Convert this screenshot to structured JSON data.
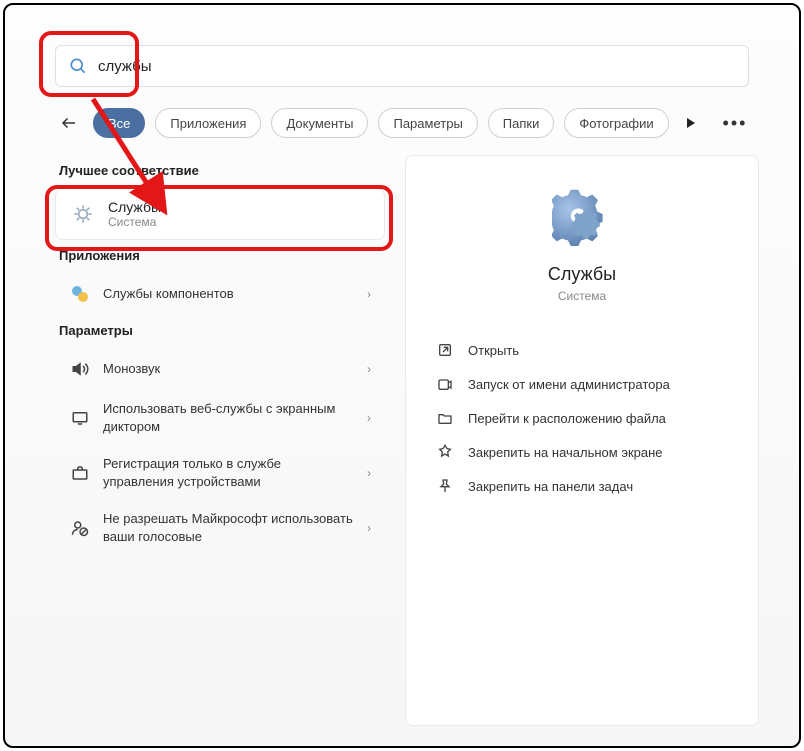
{
  "search": {
    "value": "службы"
  },
  "filters": {
    "all": "Все",
    "apps": "Приложения",
    "docs": "Документы",
    "settings_tab": "Параметры",
    "folders": "Папки",
    "photos": "Фотографии"
  },
  "sections": {
    "best_match": "Лучшее соответствие",
    "apps": "Приложения",
    "settings": "Параметры"
  },
  "bestMatch": {
    "title": "Службы",
    "subtitle": "Система"
  },
  "appsList": [
    {
      "label": "Службы компонентов"
    }
  ],
  "settingsList": [
    {
      "label": "Монозвук"
    },
    {
      "label": "Использовать веб-службы с экранным диктором"
    },
    {
      "label": "Регистрация только в службе управления устройствами"
    },
    {
      "label": "Не разрешать Майкрософт использовать ваши голосовые"
    }
  ],
  "detail": {
    "title": "Службы",
    "subtitle": "Система",
    "actions": [
      {
        "label": "Открыть"
      },
      {
        "label": "Запуск от имени администратора"
      },
      {
        "label": "Перейти к расположению файла"
      },
      {
        "label": "Закрепить на начальном экране"
      },
      {
        "label": "Закрепить на панели задач"
      }
    ]
  }
}
